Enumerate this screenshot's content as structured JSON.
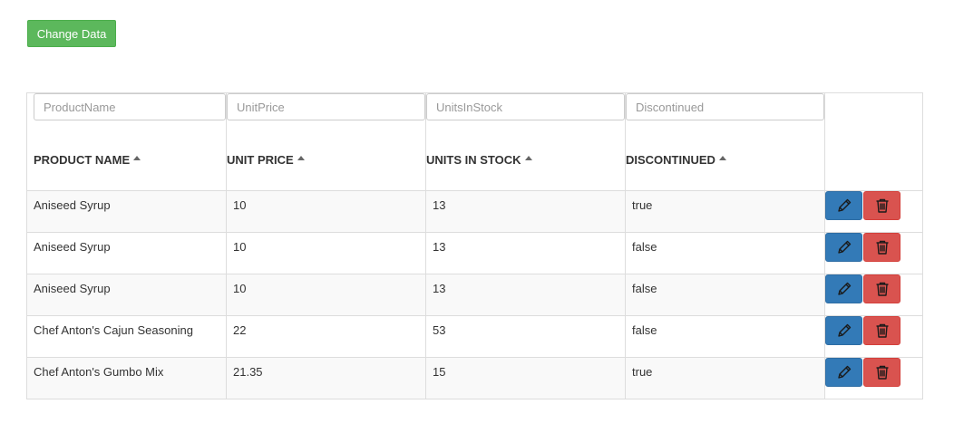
{
  "toolbar": {
    "change_data_label": "Change Data"
  },
  "grid": {
    "filters": {
      "product_name": "ProductName",
      "unit_price": "UnitPrice",
      "units_in_stock": "UnitsInStock",
      "discontinued": "Discontinued"
    },
    "headers": {
      "product_name": "PRODUCT NAME",
      "unit_price": "UNIT PRICE",
      "units_in_stock": "UNITS IN STOCK",
      "discontinued": "DISCONTINUED"
    },
    "rows": [
      {
        "product_name": "Aniseed Syrup",
        "unit_price": "10",
        "units_in_stock": "13",
        "discontinued": "true"
      },
      {
        "product_name": "Aniseed Syrup",
        "unit_price": "10",
        "units_in_stock": "13",
        "discontinued": "false"
      },
      {
        "product_name": "Aniseed Syrup",
        "unit_price": "10",
        "units_in_stock": "13",
        "discontinued": "false"
      },
      {
        "product_name": "Chef Anton's Cajun Seasoning",
        "unit_price": "22",
        "units_in_stock": "53",
        "discontinued": "false"
      },
      {
        "product_name": "Chef Anton's Gumbo Mix",
        "unit_price": "21.35",
        "units_in_stock": "15",
        "discontinued": "true"
      }
    ],
    "row_actions": {
      "edit_icon": "pencil-icon",
      "delete_icon": "trash-icon"
    }
  },
  "colors": {
    "success": "#5cb85c",
    "primary": "#337ab7",
    "danger": "#d9534f",
    "stripe": "#f9f9f9",
    "border": "#dddddd"
  }
}
